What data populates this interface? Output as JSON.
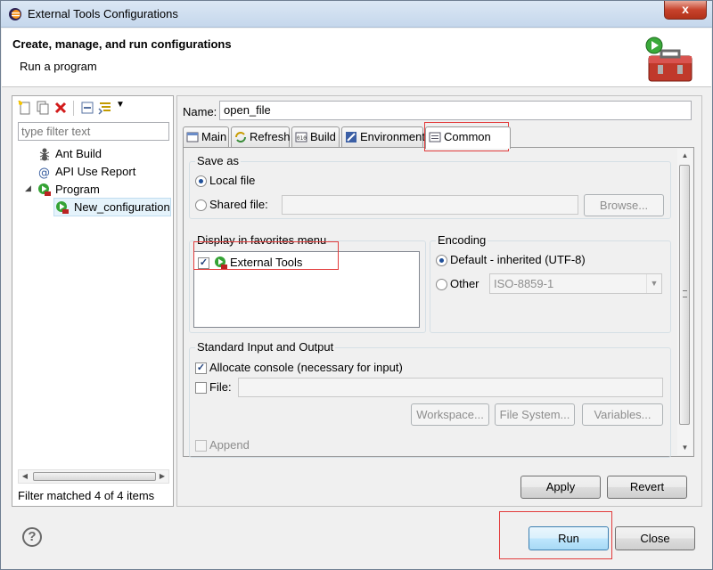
{
  "window": {
    "title": "External Tools Configurations",
    "close_glyph": "x"
  },
  "header": {
    "title": "Create, manage, and run configurations",
    "subtitle": "Run a program",
    "icon": "toolbox-run-icon"
  },
  "left": {
    "toolbar_icons": [
      "new-configuration-icon",
      "duplicate-icon",
      "delete-icon",
      "collapse-all-icon",
      "filter-icon",
      "view-menu-icon"
    ],
    "filter_placeholder": "type filter text",
    "tree": [
      {
        "label": "Ant Build",
        "icon": "ant-icon",
        "level": 0
      },
      {
        "label": "API Use Report",
        "icon": "api-report-icon",
        "level": 0
      },
      {
        "label": "Program",
        "icon": "program-icon",
        "level": 0,
        "expanded": true
      },
      {
        "label": "New_configuration",
        "icon": "program-config-icon",
        "level": 1,
        "selected": true
      }
    ],
    "status": "Filter matched 4 of 4 items"
  },
  "right": {
    "name_label": "Name:",
    "name_value": "open_file",
    "tabs": [
      {
        "label": "Main",
        "icon": "main-tab-icon"
      },
      {
        "label": "Refresh",
        "icon": "refresh-icon"
      },
      {
        "label": "Build",
        "icon": "build-icon"
      },
      {
        "label": "Environment",
        "icon": "environment-icon"
      },
      {
        "label": "Common",
        "icon": "common-tab-icon",
        "active": true
      }
    ],
    "save_as": {
      "title": "Save as",
      "local_file": "Local file",
      "shared_file": "Shared file:",
      "browse": "Browse..."
    },
    "favorites": {
      "title": "Display in favorites menu",
      "items": [
        {
          "label": "External Tools",
          "checked": true
        }
      ]
    },
    "encoding": {
      "title": "Encoding",
      "default_label": "Default - inherited (UTF-8)",
      "other_label": "Other",
      "other_value": "ISO-8859-1"
    },
    "stdio": {
      "title": "Standard Input and Output",
      "allocate_console": "Allocate console (necessary for input)",
      "file_label": "File:",
      "workspace": "Workspace...",
      "file_system": "File System...",
      "variables": "Variables...",
      "append": "Append"
    },
    "apply": "Apply",
    "revert": "Revert"
  },
  "footer": {
    "help": "?",
    "run": "Run",
    "close": "Close"
  },
  "colors": {
    "highlight_box": "#e23b3b",
    "selection": "#e5f3fb"
  }
}
